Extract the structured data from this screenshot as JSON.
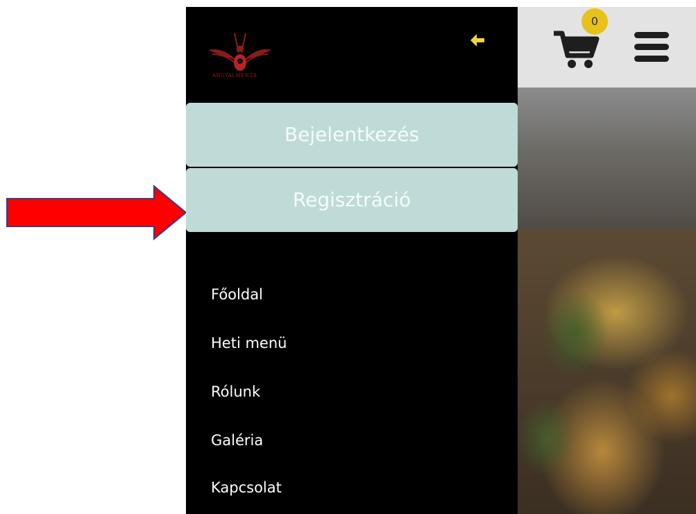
{
  "drawer": {
    "logo_text": "ANGYALMENZA",
    "back_icon": "arrow-left-icon",
    "login_label": "Bejelentkezés",
    "register_label": "Regisztráció",
    "nav_items": [
      {
        "label": "Főoldal"
      },
      {
        "label": "Heti menü"
      },
      {
        "label": "Rólunk"
      },
      {
        "label": "Galéria"
      },
      {
        "label": "Kapcsolat"
      }
    ]
  },
  "header": {
    "cart_count": "0",
    "cart_icon": "shopping-cart-icon",
    "menu_icon": "hamburger-menu-icon"
  },
  "colors": {
    "drawer_bg": "#000000",
    "auth_button_bg": "#bfdbd8",
    "accent_yellow": "#f2d24b",
    "cart_badge": "#e8c21a",
    "annotation_arrow": "#ff0000"
  }
}
